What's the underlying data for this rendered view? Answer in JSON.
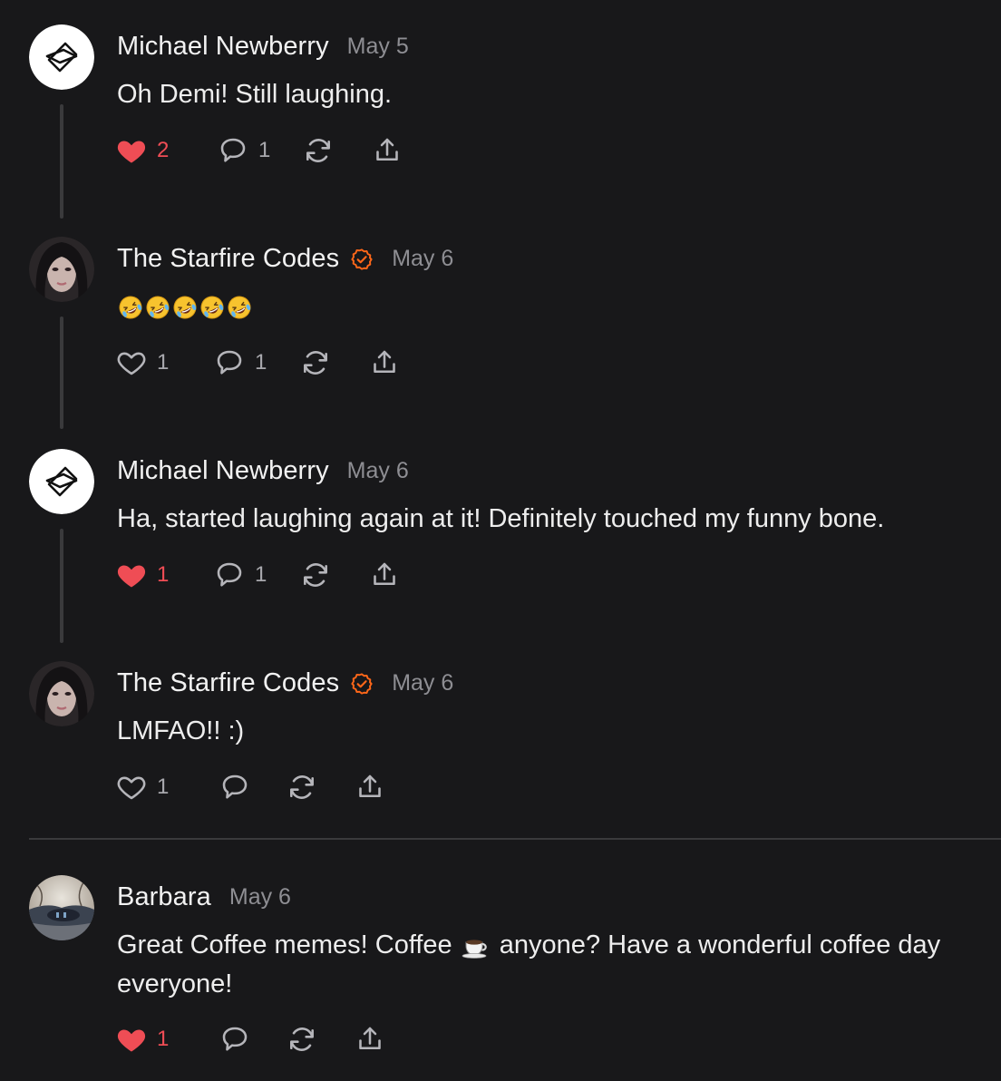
{
  "colors": {
    "background": "#18181a",
    "like_active": "#ef4d55",
    "verified_badge": "#ff6719",
    "muted_text": "#8e8e93"
  },
  "comments": [
    {
      "author": "Michael Newberry",
      "date": "May 5",
      "text": "Oh Demi! Still laughing.",
      "avatar": "logo-avatar",
      "liked": true,
      "likes": "2",
      "replies": "1"
    },
    {
      "author": "The Starfire Codes",
      "verified": true,
      "date": "May 6",
      "text": "🤣🤣🤣🤣🤣",
      "avatar": "photo-avatar",
      "liked": false,
      "likes": "1",
      "replies": "1"
    },
    {
      "author": "Michael Newberry",
      "date": "May 6",
      "text": "Ha, started laughing again at it! Definitely touched my funny bone.",
      "avatar": "logo-avatar",
      "liked": true,
      "likes": "1",
      "replies": "1"
    },
    {
      "author": "The Starfire Codes",
      "verified": true,
      "date": "May 6",
      "text": "LMFAO!! :)",
      "avatar": "photo-avatar",
      "liked": false,
      "likes": "1",
      "replies": ""
    },
    {
      "author": "Barbara",
      "date": "May 6",
      "text_before": "Great Coffee memes! Coffee",
      "text_after": "anyone? Have a wonderful coffee day everyone!",
      "avatar": "landscape-avatar",
      "liked": true,
      "likes": "1",
      "replies": ""
    }
  ],
  "icons": {
    "like": "heart-icon",
    "reply": "comment-bubble-icon",
    "restack": "restack-icon",
    "share": "share-icon",
    "verified": "verified-check-icon",
    "inline_emoji": "coffee-cup-icon"
  }
}
